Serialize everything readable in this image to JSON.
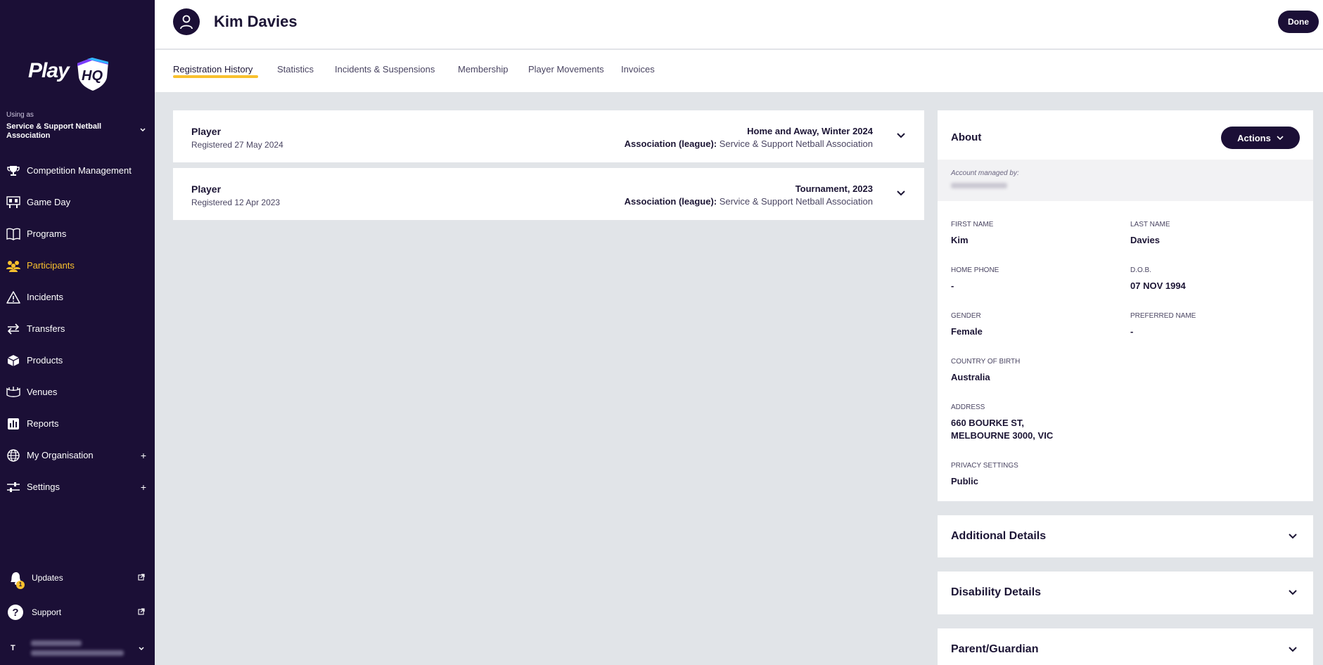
{
  "sidebar": {
    "logo_text": "Play",
    "logo_mark": "HQ",
    "using_as_label": "Using as",
    "org_name": "Service & Support Netball Association",
    "nav": [
      {
        "label": "Competition Management",
        "icon": "trophy-icon"
      },
      {
        "label": "Game Day",
        "icon": "scoreboard-icon"
      },
      {
        "label": "Programs",
        "icon": "book-icon"
      },
      {
        "label": "Participants",
        "icon": "participants-icon",
        "active": true
      },
      {
        "label": "Incidents",
        "icon": "warning-icon"
      },
      {
        "label": "Transfers",
        "icon": "transfer-arrows-icon"
      },
      {
        "label": "Products",
        "icon": "box-icon"
      },
      {
        "label": "Venues",
        "icon": "stadium-icon"
      },
      {
        "label": "Reports",
        "icon": "report-icon"
      },
      {
        "label": "My Organisation",
        "icon": "globe-icon",
        "expandable": true
      },
      {
        "label": "Settings",
        "icon": "sliders-icon",
        "expandable": true
      }
    ],
    "updates_label": "Updates",
    "updates_badge": "1",
    "support_label": "Support",
    "user_initial": "T"
  },
  "header": {
    "title": "Kim Davies",
    "done_label": "Done"
  },
  "tabs": [
    {
      "label": "Registration History",
      "active": true
    },
    {
      "label": "Statistics"
    },
    {
      "label": "Incidents & Suspensions"
    },
    {
      "label": "Membership"
    },
    {
      "label": "Player Movements"
    },
    {
      "label": "Invoices"
    }
  ],
  "registrations": [
    {
      "role": "Player",
      "date": "Registered 27 May 2024",
      "season": "Home and Away, Winter 2024",
      "assoc_label": "Association (league):",
      "assoc_value": "Service & Support Netball Association"
    },
    {
      "role": "Player",
      "date": "Registered 12 Apr 2023",
      "season": "Tournament, 2023",
      "assoc_label": "Association (league):",
      "assoc_value": "Service & Support Netball Association"
    }
  ],
  "about": {
    "title": "About",
    "actions_label": "Actions",
    "managed_by_label": "Account managed by:",
    "fields": {
      "first_name": {
        "label": "FIRST NAME",
        "value": "Kim"
      },
      "last_name": {
        "label": "LAST NAME",
        "value": "Davies"
      },
      "home_phone": {
        "label": "HOME PHONE",
        "value": "-"
      },
      "dob": {
        "label": "D.O.B.",
        "value": "07 NOV 1994"
      },
      "gender": {
        "label": "GENDER",
        "value": "Female"
      },
      "preferred_name": {
        "label": "PREFERRED NAME",
        "value": "-"
      },
      "country": {
        "label": "COUNTRY OF BIRTH",
        "value": "Australia"
      },
      "address": {
        "label": "ADDRESS",
        "line1": "660 BOURKE ST,",
        "line2": "MELBOURNE 3000, VIC"
      },
      "privacy": {
        "label": "PRIVACY SETTINGS",
        "value": "Public"
      }
    }
  },
  "sections": [
    {
      "title": "Additional Details"
    },
    {
      "title": "Disability Details"
    },
    {
      "title": "Parent/Guardian"
    }
  ],
  "colors": {
    "sidebar_bg": "#1b0f36",
    "accent": "#f9c12e",
    "page_bg": "#e1e4e8"
  }
}
